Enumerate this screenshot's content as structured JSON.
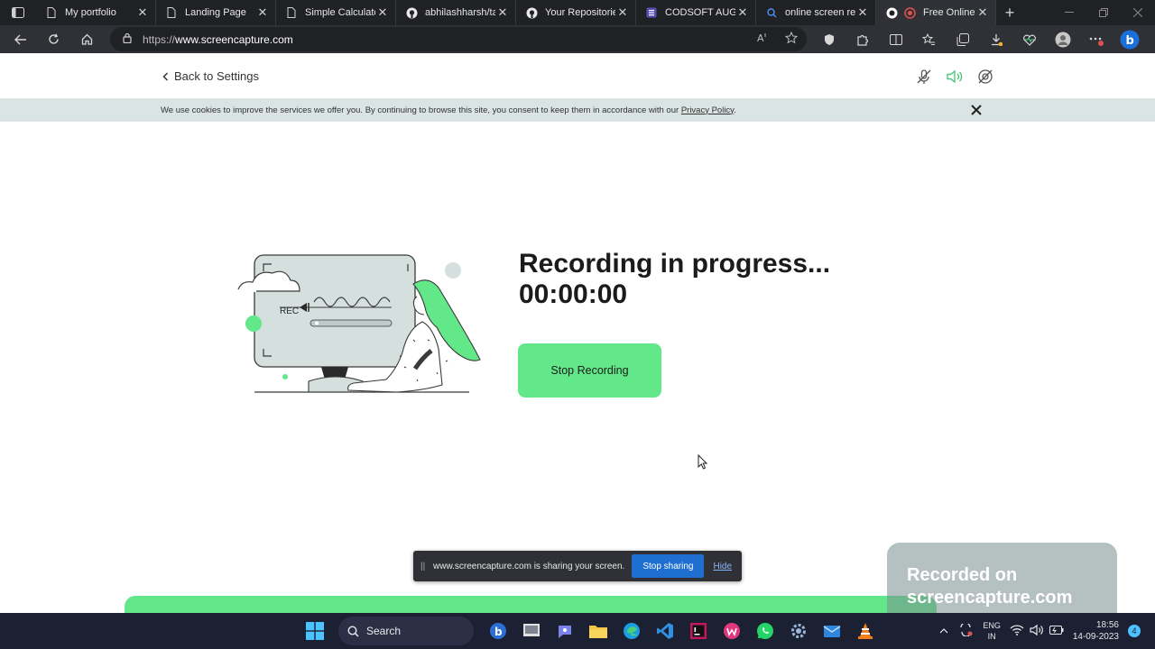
{
  "browser": {
    "tabs": [
      {
        "title": "My portfolio",
        "icon": "page-icon",
        "active": false
      },
      {
        "title": "Landing Page",
        "icon": "page-icon",
        "active": false
      },
      {
        "title": "Simple Calculator",
        "icon": "page-icon",
        "active": false
      },
      {
        "title": "abhilashharsh/tas",
        "icon": "github-icon",
        "active": false
      },
      {
        "title": "Your Repositories",
        "icon": "github-icon",
        "active": false
      },
      {
        "title": "CODSOFT AUGUS",
        "icon": "form-icon",
        "active": false
      },
      {
        "title": "online screen rec",
        "icon": "search-icon",
        "active": false
      },
      {
        "title": "Free Online",
        "icon": "screencapture-icon",
        "active": true
      }
    ],
    "close_glyph": "✕",
    "new_tab_glyph": "+",
    "address": {
      "scheme": "https://",
      "host": "www.screencapture.com"
    }
  },
  "page": {
    "back_link": "Back to Settings",
    "cookie_banner": {
      "text": "We use cookies to improve the services we offer you. By continuing to browse this site, you consent to keep them in accordance with our",
      "link": "Privacy Policy",
      "end": "."
    },
    "illustration_label": "REC",
    "status_title": "Recording in progress...",
    "timer": "00:00:00",
    "stop_button": "Stop Recording",
    "share_bar": {
      "text": "www.screencapture.com is sharing your screen.",
      "stop": "Stop sharing",
      "hide": "Hide",
      "grip": "||"
    },
    "watermark": {
      "line1": "Recorded on",
      "line2": "screencapture.com"
    },
    "accent_color": "#63e889"
  },
  "taskbar": {
    "search": "Search",
    "apps": [
      "bing-icon",
      "file-icon",
      "teams-icon",
      "folder-icon",
      "edge-icon",
      "vscode-icon",
      "intellij-icon",
      "wps-icon",
      "whatsapp-icon",
      "settings-icon",
      "mail-icon",
      "vlc-icon"
    ],
    "lang_top": "ENG",
    "lang_bottom": "IN",
    "time": "18:56",
    "date": "14-09-2023",
    "notifications": "4"
  }
}
